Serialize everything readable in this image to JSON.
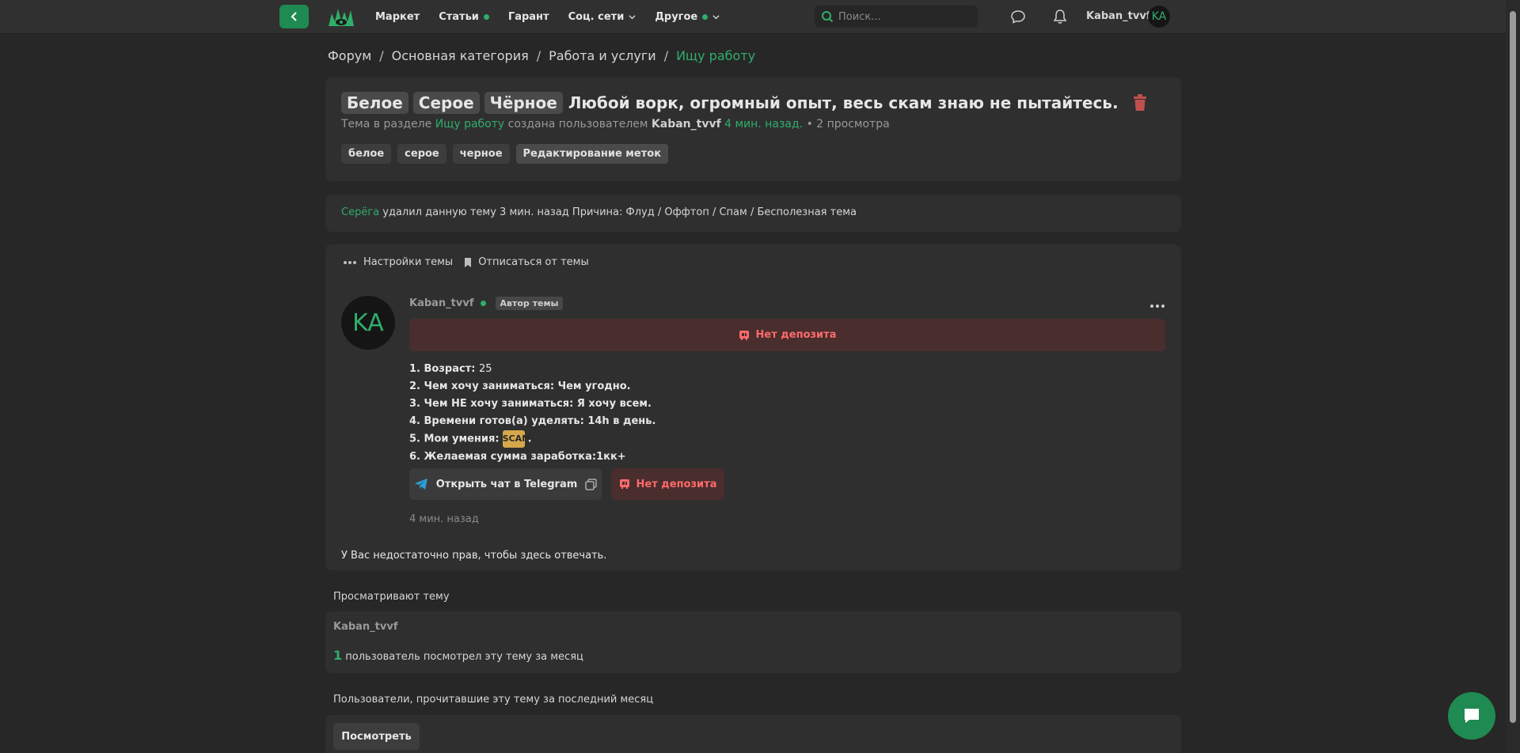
{
  "nav": {
    "items": [
      {
        "label": "Маркет",
        "dot": false,
        "chevron": false
      },
      {
        "label": "Статьи",
        "dot": true,
        "chevron": false
      },
      {
        "label": "Гарант",
        "dot": false,
        "chevron": false
      },
      {
        "label": "Соц. сети",
        "dot": false,
        "chevron": true
      },
      {
        "label": "Другое",
        "dot": true,
        "chevron": true
      }
    ],
    "search_placeholder": "Поиск...",
    "username": "Kaban_tvvf",
    "avatar_initials": "KA"
  },
  "breadcrumb": {
    "items": [
      "Форум",
      "Основная категория",
      "Работа и услуги"
    ],
    "active": "Ищу работу",
    "separator": "/"
  },
  "thread": {
    "prefixes": [
      "Белое",
      "Серое",
      "Чёрное"
    ],
    "title": "Любой ворк, огромный опыт, весь скам знаю не пытайтесь.",
    "meta_intro": "Тема в разделе",
    "meta_section": "Ищу работу",
    "meta_created": "создана пользователем",
    "meta_author": "Kaban_tvvf",
    "meta_time": "4 мин. назад.",
    "meta_views": "• 2 просмотра",
    "tags": [
      "белое",
      "серое",
      "черное"
    ],
    "edit_tags_label": "Редактирование меток"
  },
  "deletion": {
    "moderator": "Серёга",
    "text": "удалил данную тему 3 мин. назад Причина: Флуд / Оффтоп / Спам / Бесполезная тема"
  },
  "post": {
    "settings_label": "Настройки темы",
    "unsubscribe_label": "Отписаться от темы",
    "avatar_initials": "KA",
    "author": "Kaban_tvvf",
    "author_badge": "Автор темы",
    "no_deposit": "Нет депозита",
    "lines": [
      {
        "label": "1. Возраст:",
        "value": "25"
      },
      {
        "label": "2. Чем хочу заниматься:",
        "value": "Чем угодно."
      },
      {
        "label": "3. Чем НЕ хочу заниматься:",
        "value": "Я хочу всем."
      },
      {
        "label": "4. Времени готов(а) уделять:",
        "value": "14h в день."
      },
      {
        "label": "5. Мои умения:",
        "value": "."
      },
      {
        "label": "6. Желаемая сумма заработка:",
        "value": "1кк+"
      }
    ],
    "skills_image_text": "SCAM",
    "telegram_button": "Открыть чат в Telegram",
    "no_deposit_button": "Нет депозита",
    "time": "4 мин. назад",
    "no_rights": "У Вас недостаточно прав, чтобы здесь отвечать."
  },
  "viewers": {
    "heading": "Просматривают тему",
    "user": "Kaban_tvvf",
    "count": "1",
    "count_text": "пользователь посмотрел эту тему за месяц"
  },
  "readers": {
    "heading": "Пользователи, прочитавшие эту тему за последний месяц",
    "button": "Посмотреть"
  },
  "colors": {
    "accent": "#2fae6a",
    "danger": "#ff6b6b",
    "background": "#272727",
    "panel": "#2f2f2f"
  }
}
